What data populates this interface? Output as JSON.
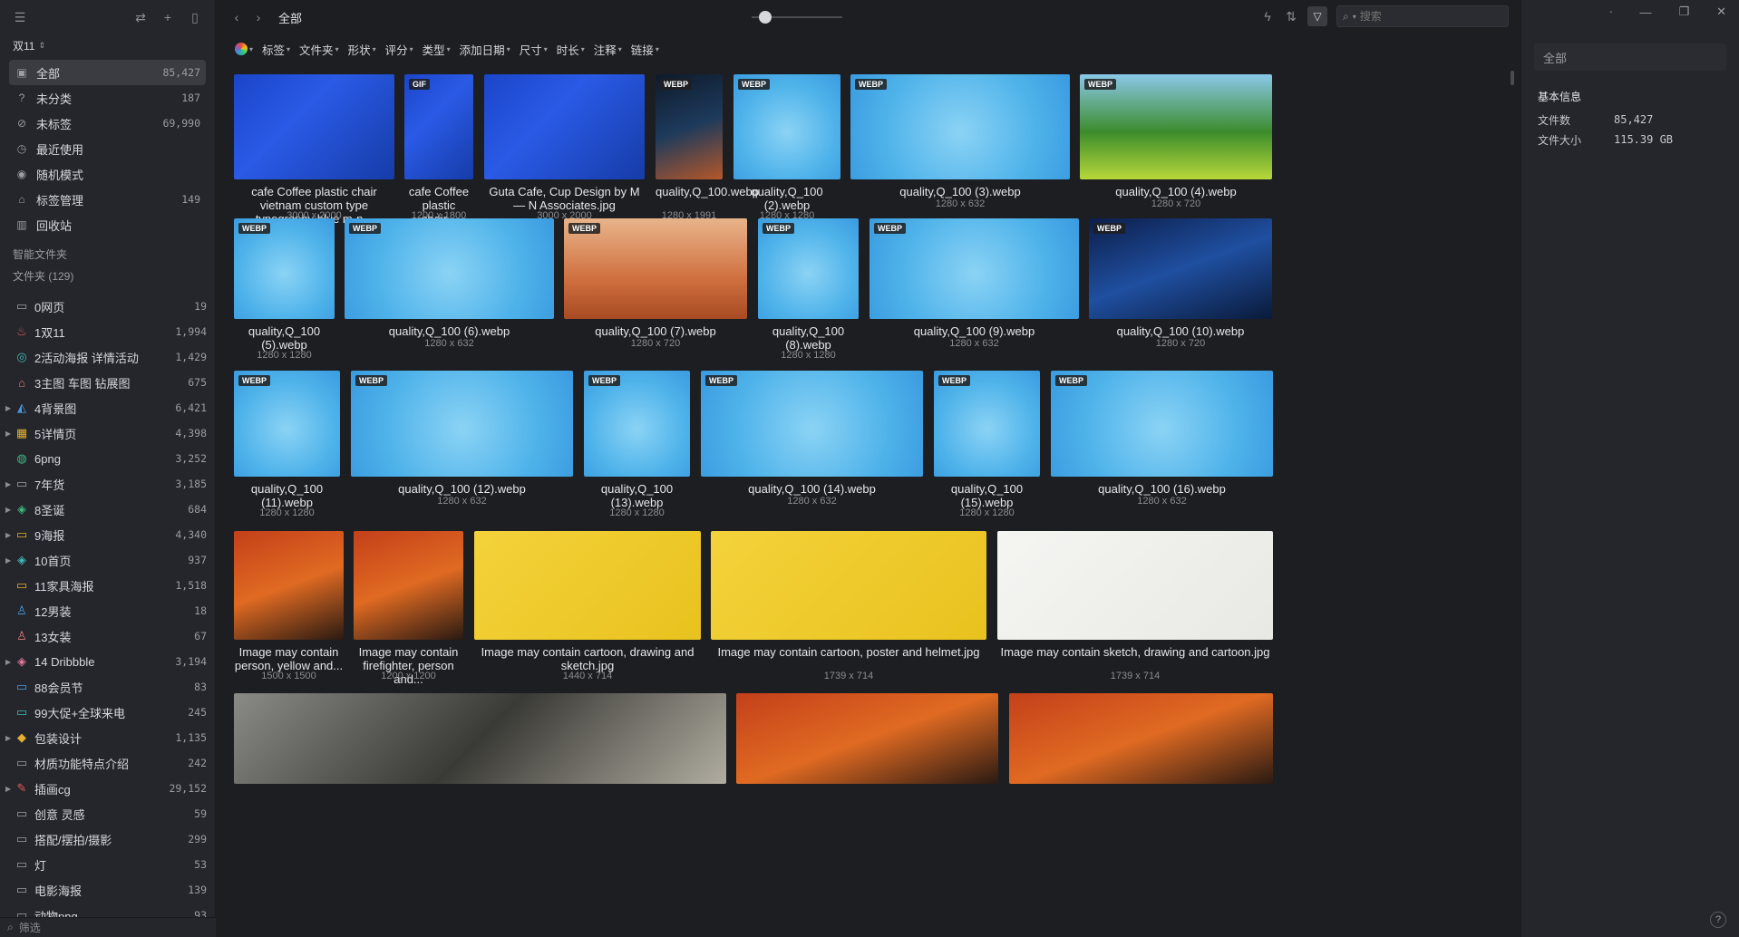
{
  "sidebar": {
    "library": "双11",
    "nav": [
      {
        "label": "全部",
        "count": "85,427",
        "icon": "image-icon"
      },
      {
        "label": "未分类",
        "count": "187",
        "icon": "question-icon"
      },
      {
        "label": "未标签",
        "count": "69,990",
        "icon": "tag-off-icon"
      },
      {
        "label": "最近使用",
        "count": "",
        "icon": "clock-icon"
      },
      {
        "label": "随机模式",
        "count": "",
        "icon": "bulb-icon"
      },
      {
        "label": "标签管理",
        "count": "149",
        "icon": "tag-icon"
      },
      {
        "label": "回收站",
        "count": "",
        "icon": "trash-icon"
      }
    ],
    "smart_folders_title": "智能文件夹",
    "folders_title": "文件夹 (129)",
    "folders": [
      {
        "label": "0网页",
        "count": "19",
        "color": "#9aa0a6",
        "expand": false
      },
      {
        "label": "1双11",
        "count": "1,994",
        "color": "#e05a5a",
        "expand": false
      },
      {
        "label": "2活动海报 详情活动",
        "count": "1,429",
        "color": "#3fb8b8",
        "expand": false
      },
      {
        "label": "3主图 车图 钻展图",
        "count": "675",
        "color": "#e07a7a",
        "expand": false
      },
      {
        "label": "4背景图",
        "count": "6,421",
        "color": "#4a9be0",
        "expand": true
      },
      {
        "label": "5详情页",
        "count": "4,398",
        "color": "#e0b030",
        "expand": true
      },
      {
        "label": "6png",
        "count": "3,252",
        "color": "#3fb880",
        "expand": false
      },
      {
        "label": "7年货",
        "count": "3,185",
        "color": "#9aa0a6",
        "expand": true
      },
      {
        "label": "8圣诞",
        "count": "684",
        "color": "#3fb880",
        "expand": true
      },
      {
        "label": "9海报",
        "count": "4,340",
        "color": "#e0b030",
        "expand": true
      },
      {
        "label": "10首页",
        "count": "937",
        "color": "#3fb8b8",
        "expand": true
      },
      {
        "label": "11家具海报",
        "count": "1,518",
        "color": "#e0b030",
        "expand": false
      },
      {
        "label": "12男装",
        "count": "18",
        "color": "#4a9be0",
        "expand": false
      },
      {
        "label": "13女装",
        "count": "67",
        "color": "#e07a7a",
        "expand": false
      },
      {
        "label": "14 Dribbble",
        "count": "3,194",
        "color": "#e07a9a",
        "expand": true
      },
      {
        "label": "88会员节",
        "count": "83",
        "color": "#4a9be0",
        "expand": false
      },
      {
        "label": "99大促+全球来电",
        "count": "245",
        "color": "#3fb8b8",
        "expand": false
      },
      {
        "label": "包装设计",
        "count": "1,135",
        "color": "#e0b030",
        "expand": true
      },
      {
        "label": "材质功能特点介绍",
        "count": "242",
        "color": "#9aa0a6",
        "expand": false
      },
      {
        "label": "插画cg",
        "count": "29,152",
        "color": "#e05a5a",
        "expand": true
      },
      {
        "label": "创意 灵感",
        "count": "59",
        "color": "#9aa0a6",
        "expand": false
      },
      {
        "label": "搭配/摆拍/摄影",
        "count": "299",
        "color": "#9aa0a6",
        "expand": false
      },
      {
        "label": "灯",
        "count": "53",
        "color": "#9aa0a6",
        "expand": false
      },
      {
        "label": "电影海报",
        "count": "139",
        "color": "#9aa0a6",
        "expand": false
      },
      {
        "label": "动物png",
        "count": "93",
        "color": "#9aa0a6",
        "expand": false
      }
    ],
    "filter_placeholder": "筛选"
  },
  "toolbar": {
    "title": "全部",
    "search_placeholder": "搜索"
  },
  "filters": [
    "标签",
    "文件夹",
    "形状",
    "评分",
    "类型",
    "添加日期",
    "尺寸",
    "时长",
    "注释",
    "链接"
  ],
  "items": [
    {
      "name": "cafe Coffee plastic chair vietnam custom type typography blue m-n...",
      "dim": "3000 x 2000",
      "badge": "",
      "style": "blue"
    },
    {
      "name": "cafe Coffee plastic chair...",
      "dim": "1200 x 1800",
      "badge": "GIF",
      "style": "blue"
    },
    {
      "name": "Guta Cafe, Cup Design by M — N Associates.jpg",
      "dim": "3000 x 2000",
      "badge": "",
      "style": "blue"
    },
    {
      "name": "quality,Q_100.webp",
      "dim": "1280 x 1991",
      "badge": "WEBP",
      "style": "dark"
    },
    {
      "name": "quality,Q_100 (2).webp",
      "dim": "1280 x 1280",
      "badge": "WEBP",
      "style": "sky"
    },
    {
      "name": "quality,Q_100 (3).webp",
      "dim": "1280 x 632",
      "badge": "WEBP",
      "style": "sky"
    },
    {
      "name": "quality,Q_100 (4).webp",
      "dim": "1280 x 720",
      "badge": "WEBP",
      "style": "green"
    },
    {
      "name": "quality,Q_100 (5).webp",
      "dim": "1280 x 1280",
      "badge": "WEBP",
      "style": "sky"
    },
    {
      "name": "quality,Q_100 (6).webp",
      "dim": "1280 x 632",
      "badge": "WEBP",
      "style": "sky"
    },
    {
      "name": "quality,Q_100 (7).webp",
      "dim": "1280 x 720",
      "badge": "WEBP",
      "style": "desert"
    },
    {
      "name": "quality,Q_100 (8).webp",
      "dim": "1280 x 1280",
      "badge": "WEBP",
      "style": "sky"
    },
    {
      "name": "quality,Q_100 (9).webp",
      "dim": "1280 x 632",
      "badge": "WEBP",
      "style": "sky"
    },
    {
      "name": "quality,Q_100 (10).webp",
      "dim": "1280 x 720",
      "badge": "WEBP",
      "style": "night"
    },
    {
      "name": "quality,Q_100 (11).webp",
      "dim": "1280 x 1280",
      "badge": "WEBP",
      "style": "sky"
    },
    {
      "name": "quality,Q_100 (12).webp",
      "dim": "1280 x 632",
      "badge": "WEBP",
      "style": "sky"
    },
    {
      "name": "quality,Q_100 (13).webp",
      "dim": "1280 x 1280",
      "badge": "WEBP",
      "style": "sky"
    },
    {
      "name": "quality,Q_100 (14).webp",
      "dim": "1280 x 632",
      "badge": "WEBP",
      "style": "sky"
    },
    {
      "name": "quality,Q_100 (15).webp",
      "dim": "1280 x 1280",
      "badge": "WEBP",
      "style": "sky"
    },
    {
      "name": "quality,Q_100 (16).webp",
      "dim": "1280 x 632",
      "badge": "WEBP",
      "style": "sky"
    },
    {
      "name": "Image may contain person, yellow and...",
      "dim": "1500 x 1500",
      "badge": "",
      "style": "orange"
    },
    {
      "name": "Image may contain firefighter, person and...",
      "dim": "1200 x 1200",
      "badge": "",
      "style": "orange"
    },
    {
      "name": "Image may contain cartoon, drawing and sketch.jpg",
      "dim": "1440 x 714",
      "badge": "",
      "style": "yellow"
    },
    {
      "name": "Image may contain cartoon, poster and helmet.jpg",
      "dim": "1739 x 714",
      "badge": "",
      "style": "yellow"
    },
    {
      "name": "Image may contain sketch, drawing and cartoon.jpg",
      "dim": "1739 x 714",
      "badge": "",
      "style": "sketch"
    },
    {
      "name": "",
      "dim": "",
      "badge": "",
      "style": "photo"
    },
    {
      "name": "",
      "dim": "",
      "badge": "",
      "style": "orange"
    },
    {
      "name": "",
      "dim": "",
      "badge": "",
      "style": "orange"
    }
  ],
  "info_panel": {
    "name_placeholder": "全部",
    "section": "基本信息",
    "rows": [
      {
        "key": "文件数",
        "value": "85,427"
      },
      {
        "key": "文件大小",
        "value": "115.39 GB"
      }
    ]
  }
}
